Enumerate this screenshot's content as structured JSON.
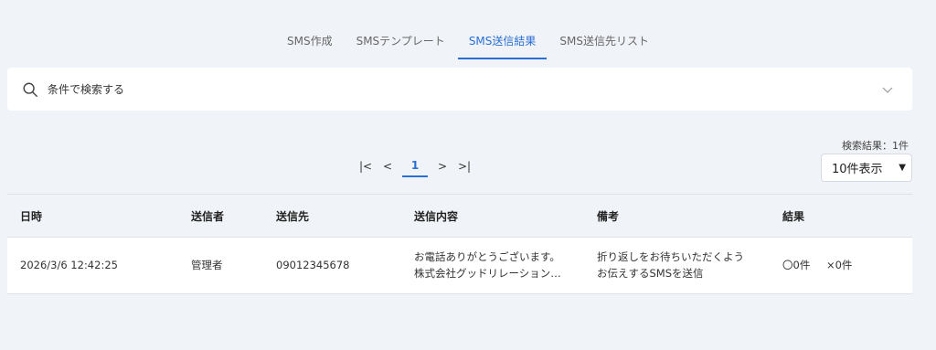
{
  "tabs": [
    {
      "label": "SMS作成"
    },
    {
      "label": "SMSテンプレート"
    },
    {
      "label": "SMS送信結果"
    },
    {
      "label": "SMS送信先リスト"
    }
  ],
  "search": {
    "label": "条件で検索する"
  },
  "results": {
    "count_text": "検索結果：1件",
    "per_page": "10件表示"
  },
  "pagination": {
    "first": "|<",
    "prev": "<",
    "current": "1",
    "next": ">",
    "last": ">|"
  },
  "table": {
    "headers": [
      "日時",
      "送信者",
      "送信先",
      "送信内容",
      "備考",
      "結果"
    ],
    "rows": [
      {
        "datetime": "2026/3/6 12:42:25",
        "sender": "管理者",
        "destination": "09012345678",
        "content_line1": "お電話ありがとうございます。",
        "content_line2": "株式会社グッドリレーション…",
        "note_line1": "折り返しをお待ちいただくよう",
        "note_line2": "お伝えするSMSを送信",
        "result_ok": "〇0件",
        "result_ng": "×0件"
      }
    ]
  },
  "colors": {
    "accent": "#2a6fd6",
    "background": "#f0f3f7"
  }
}
